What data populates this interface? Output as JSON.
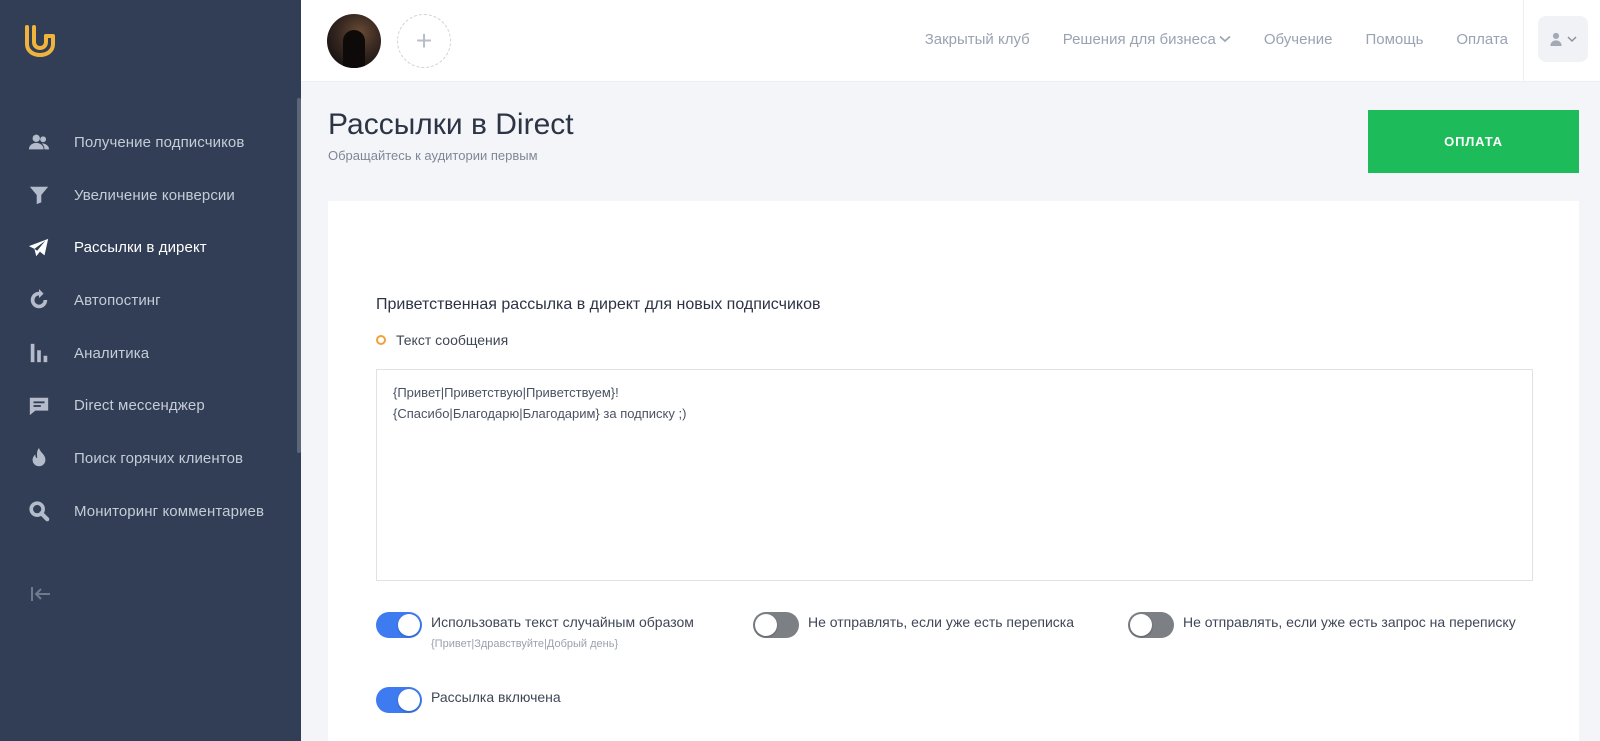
{
  "sidebar": {
    "items": [
      {
        "label": "Получение подписчиков",
        "icon": "users-icon"
      },
      {
        "label": "Увеличение конверсии",
        "icon": "funnel-icon"
      },
      {
        "label": "Рассылки в директ",
        "icon": "paper-plane-icon",
        "active": true
      },
      {
        "label": "Автопостинг",
        "icon": "refresh-icon"
      },
      {
        "label": "Аналитика",
        "icon": "bar-chart-icon"
      },
      {
        "label": "Direct мессенджер",
        "icon": "message-icon"
      },
      {
        "label": "Поиск горячих клиентов",
        "icon": "fire-icon"
      },
      {
        "label": "Мониторинг комментариев",
        "icon": "search-icon"
      }
    ]
  },
  "topbar": {
    "add_account": "+",
    "nav": [
      "Закрытый клуб",
      "Решения для бизнеса",
      "Обучение",
      "Помощь",
      "Оплата"
    ]
  },
  "header": {
    "title": "Рассылки в Direct",
    "subtitle": "Обращайтесь к аудитории первым",
    "pay_button": "ОПЛАТА"
  },
  "card": {
    "section_title": "Приветственная рассылка в директ для новых подписчиков",
    "field_label": "Текст сообщения",
    "message": "{Привет|Приветствую|Приветствуем}!\n{Спасибо|Благодарю|Благодарим} за подписку ;)",
    "toggles": {
      "random_text": {
        "label": "Использовать текст случайным образом",
        "hint": "{Привет|Здравствуйте|Добрый день}",
        "on": true
      },
      "skip_conversation": {
        "label": "Не отправлять, если уже есть переписка",
        "on": false
      },
      "skip_request": {
        "label": "Не отправлять, если уже есть запрос на переписку",
        "on": false
      },
      "enabled": {
        "label": "Рассылка включена",
        "on": true
      }
    }
  },
  "colors": {
    "sidebar_bg": "#313e55",
    "accent_green": "#1dbb5a",
    "toggle_on": "#3e7bf0",
    "toggle_off": "#7c7f84",
    "label_dot": "#f0a23a"
  }
}
